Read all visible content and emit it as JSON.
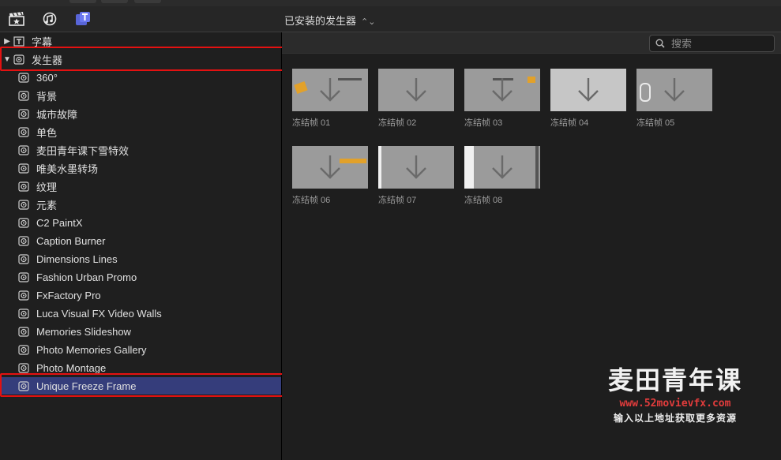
{
  "toolbar": {
    "icons": [
      "clapper-icon",
      "music-photo-icon",
      "titles-generators-icon"
    ],
    "browser_title": "已安装的发生器"
  },
  "sidebar": {
    "categories": [
      {
        "label": "字幕",
        "expanded": false
      },
      {
        "label": "发生器",
        "expanded": true
      }
    ],
    "items": [
      "360°",
      "背景",
      "城市故障",
      "单色",
      "麦田青年课下雪特效",
      "唯美水墨转场",
      "纹理",
      "元素",
      "C2 PaintX",
      "Caption Burner",
      "Dimensions Lines",
      "Fashion Urban Promo",
      "FxFactory Pro",
      "Luca Visual FX Video Walls",
      "Memories Slideshow",
      "Photo Memories Gallery",
      "Photo Montage",
      "Unique Freeze Frame"
    ],
    "selected": "Unique Freeze Frame"
  },
  "search": {
    "placeholder": "搜索",
    "value": ""
  },
  "browser": {
    "tiles": [
      "冻结帧 01",
      "冻结帧 02",
      "冻结帧 03",
      "冻结帧 04",
      "冻结帧 05",
      "冻结帧 06",
      "冻结帧 07",
      "冻结帧 08"
    ]
  },
  "watermark": {
    "title": "麦田青年课",
    "url": "www.52movievfx.com",
    "subtitle": "输入以上地址获取更多资源"
  },
  "colors": {
    "selection": "#353d7b",
    "highlight_box": "#e41111",
    "watermark_url": "#e23c3c"
  }
}
